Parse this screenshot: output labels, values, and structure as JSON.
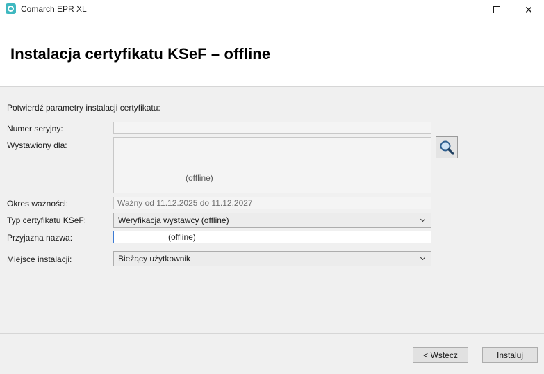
{
  "window": {
    "title": "Comarch EPR XL",
    "minimize_glyph": "—",
    "close_glyph": "✕"
  },
  "header": {
    "title": "Instalacja certyfikatu KSeF – offline"
  },
  "form": {
    "prompt": "Potwierdź parametry instalacji certyfikatu:",
    "serial": {
      "label": "Numer seryjny:",
      "value": ""
    },
    "issued_for": {
      "label": "Wystawiony dla:",
      "last_line": "(offline)"
    },
    "validity": {
      "label": "Okres ważności:",
      "value": "Ważny od 11.12.2025 do 11.12.2027"
    },
    "cert_type": {
      "label": "Typ certyfikatu KSeF:",
      "value": "Weryfikacja wystawcy (offline)"
    },
    "friendly_name": {
      "label": "Przyjazna nazwa:",
      "value": "(offline)"
    },
    "location": {
      "label": "Miejsce instalacji:",
      "value": "Bieżący użytkownik"
    }
  },
  "buttons": {
    "back": "< Wstecz",
    "install": "Instaluj"
  },
  "icons": {
    "app": "app-gear-icon",
    "search": "magnifier-icon"
  },
  "colors": {
    "accent_focus": "#3d7bd4",
    "app_icon": "#3fb8c0"
  }
}
